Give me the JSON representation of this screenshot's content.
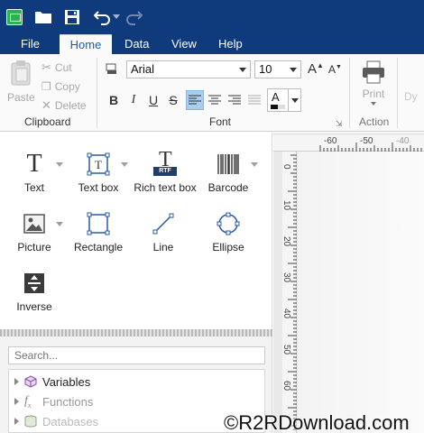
{
  "menu": {
    "tabs": [
      {
        "label": "File"
      },
      {
        "label": "Home"
      },
      {
        "label": "Data"
      },
      {
        "label": "View"
      },
      {
        "label": "Help"
      }
    ]
  },
  "ribbon": {
    "clipboard": {
      "paste": "Paste",
      "cut": "Cut",
      "copy": "Copy",
      "delete": "Delete",
      "label": "Clipboard"
    },
    "font": {
      "family": "Arial",
      "size": "10",
      "bold": "B",
      "italic": "I",
      "underline": "U",
      "strike": "S",
      "label": "Font",
      "color_letter": "A"
    },
    "action": {
      "print": "Print",
      "label": "Action",
      "partial": "Dy"
    }
  },
  "tools": [
    {
      "label": "Text"
    },
    {
      "label": "Text box"
    },
    {
      "label": "Rich text box"
    },
    {
      "label": "Barcode"
    },
    {
      "label": "Picture"
    },
    {
      "label": "Rectangle"
    },
    {
      "label": "Line"
    },
    {
      "label": "Ellipse"
    },
    {
      "label": "Inverse"
    }
  ],
  "rtf_badge": "RTF",
  "search": {
    "placeholder": "Search..."
  },
  "tree": [
    {
      "label": "Variables"
    },
    {
      "label": "Functions"
    },
    {
      "label": "Databases"
    }
  ],
  "ruler": {
    "h": [
      "-60",
      "-50",
      "-40"
    ],
    "v": [
      "0",
      "10",
      "20",
      "30",
      "40",
      "50",
      "60"
    ]
  },
  "watermark": "©R2RDownload.com",
  "colors": {
    "titlebar": "#0f3b7d",
    "accent": "#1d5ea8",
    "active_fmt": "#a9cdee"
  }
}
